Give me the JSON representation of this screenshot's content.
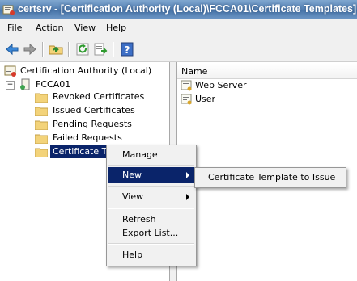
{
  "window": {
    "title": "certsrv - [Certification Authority (Local)\\FCCA01\\Certificate Templates]"
  },
  "menubar": {
    "items": [
      "File",
      "Action",
      "View",
      "Help"
    ]
  },
  "toolbar": {
    "icons": [
      "back-icon",
      "forward-icon",
      "up-folder-icon",
      "refresh-icon",
      "export-list-icon",
      "help-icon"
    ]
  },
  "tree": {
    "root": "Certification Authority (Local)",
    "ca": "FCCA01",
    "collapse_glyph": "−",
    "folders": [
      "Revoked Certificates",
      "Issued Certificates",
      "Pending Requests",
      "Failed Requests",
      "Certificate Te"
    ]
  },
  "list": {
    "column": "Name",
    "items": [
      "Web Server",
      "User"
    ]
  },
  "context_menu": {
    "items": {
      "manage": "Manage",
      "new": "New",
      "view": "View",
      "refresh": "Refresh",
      "export": "Export List...",
      "help": "Help"
    }
  },
  "submenu": {
    "item": "Certificate Template to Issue"
  },
  "colors": {
    "selection": "#0a246a",
    "titlebar": "#5a86b8",
    "folder": "#f3d37a"
  }
}
